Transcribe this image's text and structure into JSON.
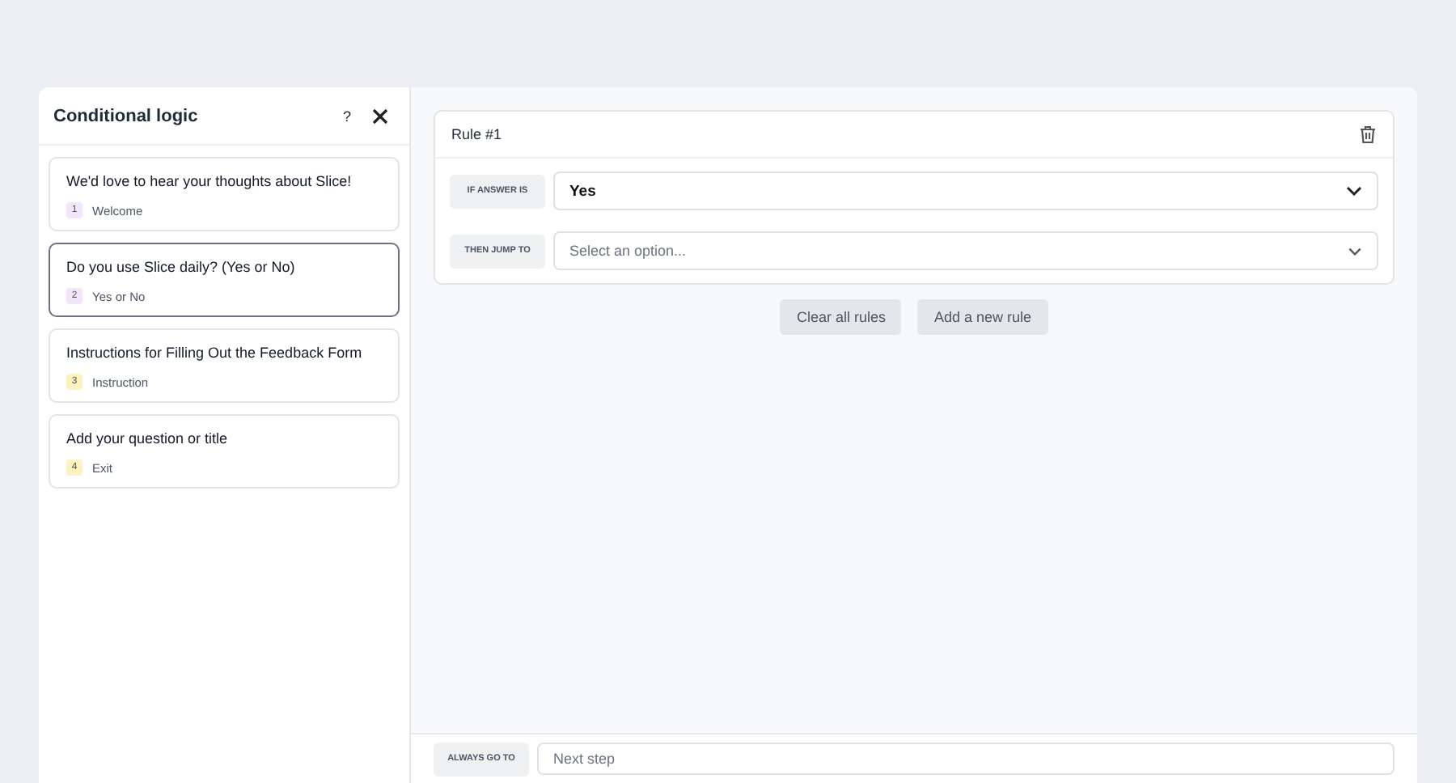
{
  "dialog": {
    "title": "Conditional logic",
    "help": "?"
  },
  "questions": [
    {
      "title": "We'd love to hear your thoughts about Slice!",
      "number": "1",
      "type": "Welcome",
      "color": "#f3e6fa",
      "selected": false
    },
    {
      "title": "Do you use Slice daily? (Yes or No)",
      "number": "2",
      "type": "Yes or No",
      "color": "#f3e6fa",
      "selected": true
    },
    {
      "title": "Instructions for Filling Out the Feedback Form",
      "number": "3",
      "type": "Instruction",
      "color": "#fdf2c2",
      "selected": false
    },
    {
      "title": "Add your question or title",
      "number": "4",
      "type": "Exit",
      "color": "#fdf2c2",
      "selected": false
    }
  ],
  "rule": {
    "title": "Rule #1",
    "if_label": "IF ANSWER IS",
    "if_value": "Yes",
    "then_label": "THEN JUMP TO",
    "then_placeholder": "Select an option..."
  },
  "actions": [
    "Clear all rules",
    "Add a new rule"
  ],
  "footer": {
    "label": "ALWAYS GO TO",
    "value": "Next step"
  }
}
